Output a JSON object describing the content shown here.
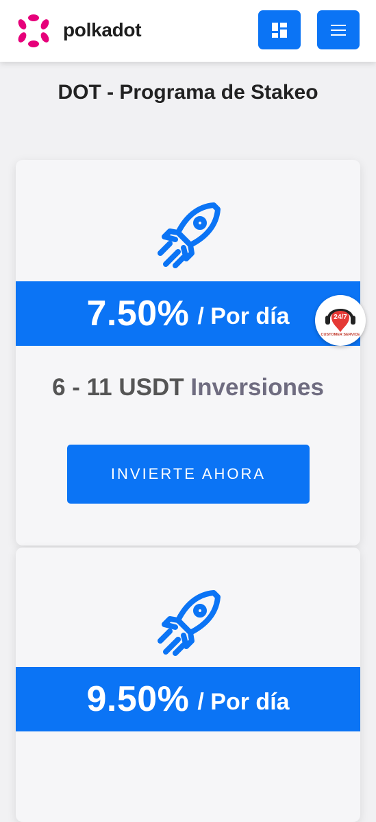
{
  "header": {
    "brand": "polkadot",
    "dashboard_button_icon": "dashboard-grid-icon",
    "menu_button_icon": "hamburger-menu-icon"
  },
  "page_title": "DOT - Programa de Stakeo",
  "colors": {
    "accent": "#0b74f5",
    "brand_pink": "#e6007a"
  },
  "plans": [
    {
      "icon": "rocket-icon",
      "rate": "7.50%",
      "rate_period": "/ Por día",
      "range": "6 - 11 USDT",
      "range_label": "Inversiones",
      "button_label": "INVIERTE AHORA"
    },
    {
      "icon": "rocket-icon",
      "rate": "9.50%",
      "rate_period": "/ Por día"
    }
  ],
  "support_widget": {
    "badge": "24/7",
    "caption": "CUSTOMER SERVICE"
  }
}
